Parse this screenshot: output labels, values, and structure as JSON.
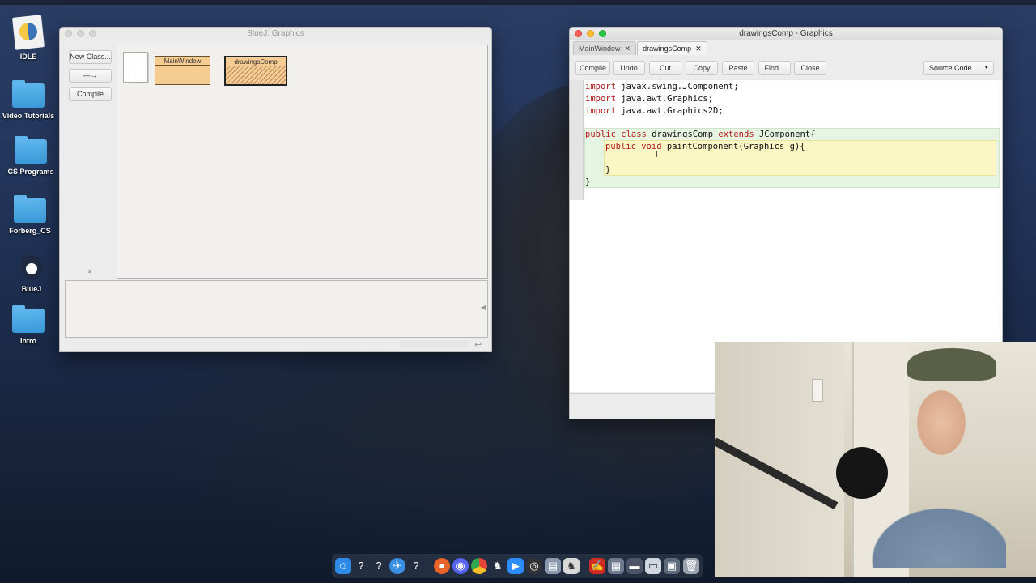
{
  "desktop": {
    "icons": [
      {
        "label": "IDLE",
        "kind": "app"
      },
      {
        "label": "Video Tutorials",
        "kind": "folder"
      },
      {
        "label": "CS Programs",
        "kind": "folder"
      },
      {
        "label": "Forberg_CS",
        "kind": "folder"
      },
      {
        "label": "BlueJ",
        "kind": "app"
      },
      {
        "label": "Intro",
        "kind": "folder"
      }
    ]
  },
  "bluej": {
    "title": "BlueJ: Graphics",
    "buttons": {
      "new_class": "New Class...",
      "arrow": "—→",
      "compile": "Compile"
    },
    "classes": [
      {
        "name": "MainWindow",
        "state": "compiled"
      },
      {
        "name": "drawingsComp",
        "state": "uncompiled"
      }
    ]
  },
  "editor": {
    "title": "drawingsComp - Graphics",
    "tabs": [
      {
        "label": "MainWindow",
        "close": "✕"
      },
      {
        "label": "drawingsComp",
        "close": "✕",
        "active": true
      }
    ],
    "toolbar": {
      "compile": "Compile",
      "undo": "Undo",
      "cut": "Cut",
      "copy": "Copy",
      "paste": "Paste",
      "find": "Find...",
      "close": "Close",
      "view_select": "Source Code"
    },
    "code": {
      "l1_kw": "import",
      "l1_rest": " javax.swing.JComponent;",
      "l2_kw": "import",
      "l2_rest": " java.awt.Graphics;",
      "l3_kw": "import",
      "l3_rest": " java.awt.Graphics2D;",
      "l5_kw1": "public",
      "l5_kw2": " class",
      "l5_mid": " drawingsComp",
      "l5_kw3": " extends",
      "l5_rest": " JComponent{",
      "l6_kw1": "public",
      "l6_kw2": " void",
      "l6_rest": " paintComponent(Graphics g){",
      "l8": "}",
      "l9": "}"
    }
  },
  "colors": {
    "keyword": "#b41a1a",
    "class_scope": "#e6f5e2",
    "method_scope": "#fbf7c4",
    "class_box": "#f5cc92"
  },
  "dock": {
    "icons": [
      "finder-icon",
      "help-icon",
      "help-icon",
      "safari-icon",
      "help-icon",
      "firefox-icon",
      "discord-icon",
      "chrome-icon",
      "bluej-dock-icon",
      "zoom-icon",
      "obs-icon",
      "app-icon",
      "bluej-dock-icon",
      "acrobat-icon",
      "app-icon",
      "app-icon",
      "app-icon",
      "app-icon",
      "app-icon",
      "trash-icon"
    ]
  }
}
